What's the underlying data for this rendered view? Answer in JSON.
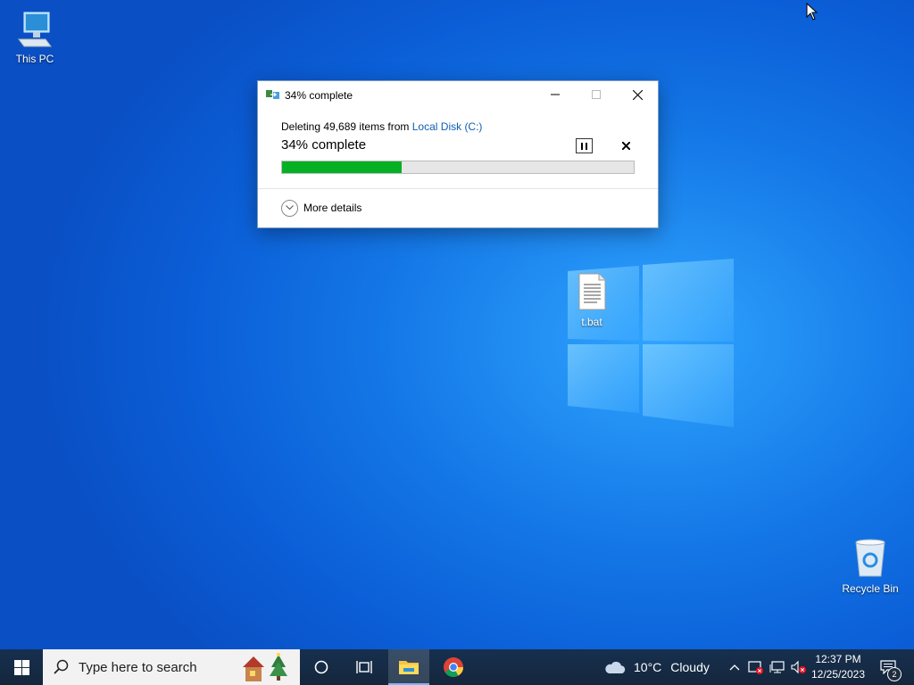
{
  "desktop": {
    "icons": [
      {
        "name": "This PC"
      },
      {
        "name": "t.bat"
      },
      {
        "name": "Recycle Bin"
      }
    ]
  },
  "dialog": {
    "title": "34% complete",
    "deleting_prefix": "Deleting 49,689 items from ",
    "source_link": "Local Disk (C:)",
    "percent_text": "34% complete",
    "progress_fraction": 0.34,
    "more_details": "More details",
    "progress_color": "#06b025"
  },
  "taskbar": {
    "search_placeholder": "Type here to search",
    "weather_temp": "10°C",
    "weather_condition": "Cloudy",
    "time": "12:37 PM",
    "date": "12/25/2023",
    "notification_count": "2",
    "pinned": [
      "cortana-icon",
      "task-view-icon",
      "file-explorer-icon",
      "chrome-icon"
    ]
  }
}
